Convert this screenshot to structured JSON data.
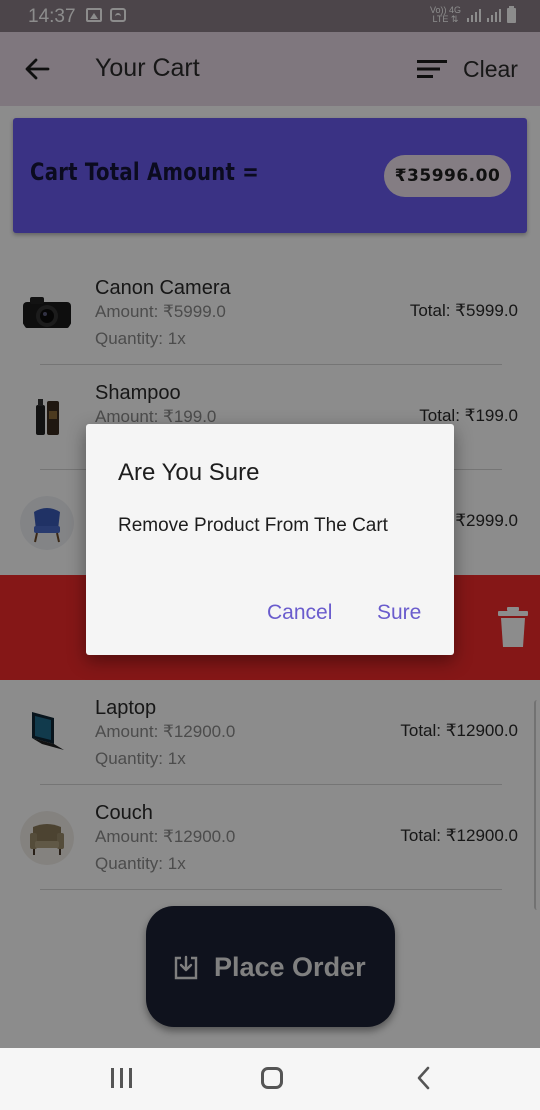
{
  "status_bar": {
    "time": "14:37",
    "network_top": "Vo)) 4G",
    "network_bottom": "LTE ⇅"
  },
  "app_bar": {
    "title": "Your Cart",
    "clear_label": "Clear",
    "back_icon": "arrow-left-icon",
    "sort_icon": "sort-lines-icon"
  },
  "cart_total": {
    "label": "Cart Total Amount =",
    "amount": "₹35996.00",
    "card_color": "#6b5cf0"
  },
  "items": [
    {
      "name": "Canon Camera",
      "amount": "Amount:  ₹5999.0",
      "quantity": "Quantity: 1x",
      "total": "Total:  ₹5999.0",
      "icon": "camera-icon"
    },
    {
      "name": "Shampoo",
      "amount": "Amount:  ₹199.0",
      "quantity": "Quantity: 1x",
      "total": "Total:  ₹199.0",
      "icon": "shampoo-bottle-icon"
    },
    {
      "name": "",
      "amount": "",
      "quantity": "",
      "total": "₹2999.0",
      "icon": "chair-icon"
    },
    {
      "name": "Laptop",
      "amount": "Amount:  ₹12900.0",
      "quantity": "Quantity: 1x",
      "total": "Total:  ₹12900.0",
      "icon": "laptop-icon"
    },
    {
      "name": "Couch",
      "amount": "Amount:  ₹12900.0",
      "quantity": "Quantity: 1x",
      "total": "Total:  ₹12900.0",
      "icon": "couch-icon"
    }
  ],
  "swipe_delete": {
    "icon": "trash-icon",
    "color": "#f22a2a"
  },
  "place_order": {
    "label": "Place Order",
    "icon": "download-box-icon"
  },
  "dialog": {
    "title": "Are You Sure",
    "message": "Remove Product From The Cart",
    "cancel_label": "Cancel",
    "confirm_label": "Sure",
    "button_color": "#6a5ccd"
  },
  "nav_bar": {
    "recent_icon": "recent-apps-icon",
    "home_icon": "home-icon",
    "back_icon": "back-chevron-icon"
  }
}
